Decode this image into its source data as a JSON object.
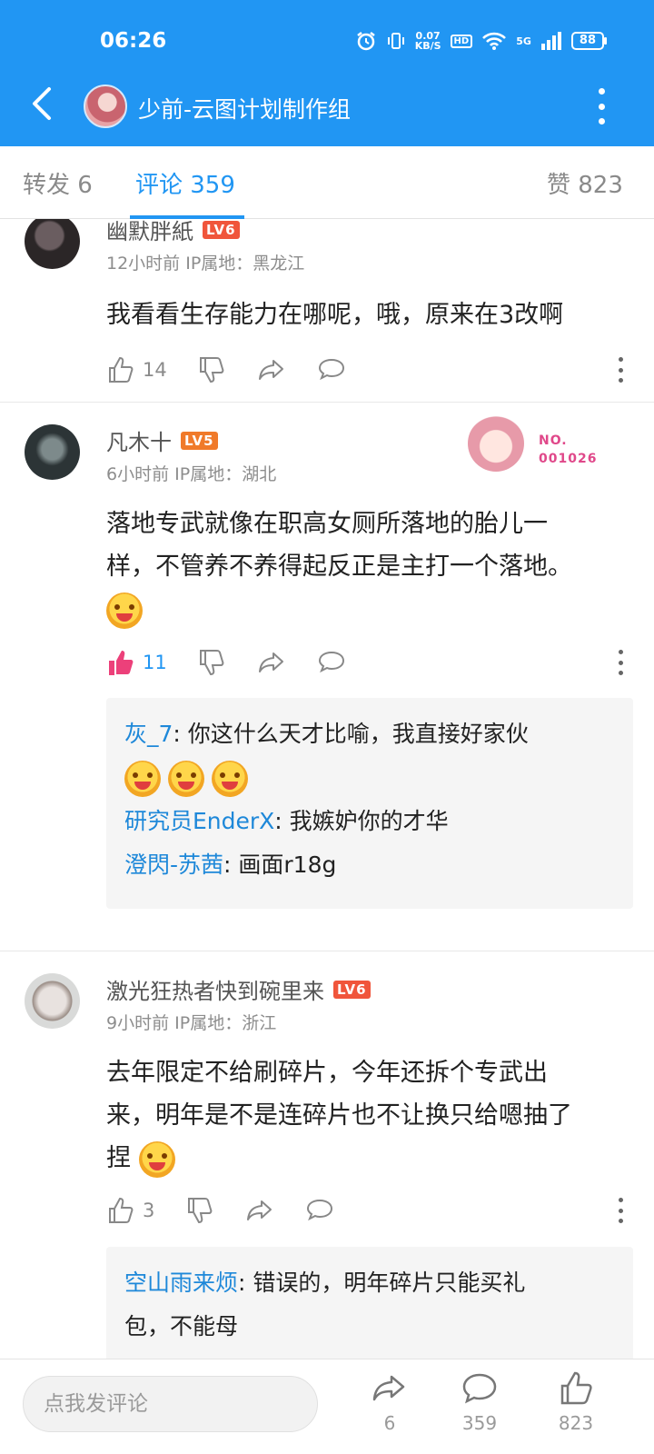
{
  "status_bar": {
    "time": "06:26",
    "speed_value": "0.07",
    "speed_unit": "KB/S",
    "hd": "HD",
    "signal_label": "5G",
    "battery": "88"
  },
  "header": {
    "title": "少前-云图计划制作组"
  },
  "tabs": [
    {
      "label": "转发 6"
    },
    {
      "label": "评论 359"
    },
    {
      "label": "赞 823"
    }
  ],
  "comments": [
    {
      "user": "幽默胖紙",
      "level": "LV6",
      "meta": "12小时前  IP属地：黑龙江",
      "text": "我看看生存能力在哪呢，哦，原来在3改啊",
      "likes": "14"
    },
    {
      "user": "凡木十",
      "level": "LV5",
      "meta": "6小时前  IP属地：湖北",
      "text_line1": "落地专武就像在职高女厕所落地的胎儿一",
      "text_line2": "样，不管养不养得起反正是主打一个落地。",
      "likes": "11",
      "badge": {
        "line1": "NO.",
        "line2": "001026"
      },
      "replies": [
        {
          "name": "灰_7",
          "text": ": 你这什么天才比喻，我直接好家伙"
        },
        {
          "name": "研究员EnderX",
          "text": ": 我嫉妒你的才华"
        },
        {
          "name": "澄閃-苏茜",
          "text": ": 画面r18g"
        }
      ]
    },
    {
      "user": "激光狂热者快到碗里来",
      "level": "LV6",
      "meta": "9小时前  IP属地：浙江",
      "text_line1": "去年限定不给刷碎片，今年还拆个专武出",
      "text_line2": "来，明年是不是连碎片也不让换只给嗯抽了",
      "text_line3": "捏",
      "likes": "3",
      "replies": [
        {
          "name": "空山雨来烦",
          "text": ": 错误的，明年碎片只能买礼"
        },
        {
          "name": "",
          "text": "包，不能母"
        }
      ]
    }
  ],
  "bottom_bar": {
    "placeholder": "点我发评论",
    "repost_count": "6",
    "comment_count": "359",
    "like_count": "823"
  },
  "colors": {
    "accent": "#2196f3",
    "like_active": "#ec407a",
    "level_badge": "#f0553b",
    "reply_name": "#1e88d9"
  }
}
